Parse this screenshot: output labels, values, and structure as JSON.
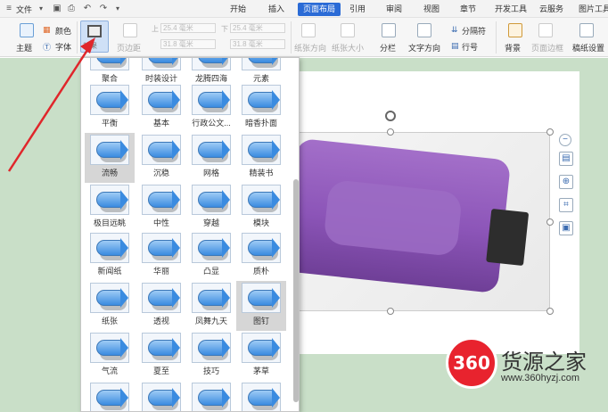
{
  "menubar": {
    "file_label": "文件",
    "tabs": [
      {
        "label": "开始",
        "active": false
      },
      {
        "label": "插入",
        "active": false
      },
      {
        "label": "页面布局",
        "active": true
      },
      {
        "label": "引用",
        "active": false
      },
      {
        "label": "审阅",
        "active": false
      },
      {
        "label": "视图",
        "active": false
      },
      {
        "label": "章节",
        "active": false
      },
      {
        "label": "开发工具",
        "active": false
      },
      {
        "label": "云服务",
        "active": false
      },
      {
        "label": "图片工具",
        "active": false
      }
    ]
  },
  "ribbon": {
    "theme_label": "主题",
    "color_label": "颜色",
    "font_label": "字体",
    "effect_label": "效果",
    "margin_label": "页边距",
    "top_label": "上",
    "bottom_label": "下",
    "top_value": "25.4 毫米",
    "bottom_value": "25.4 毫米",
    "left_value": "31.8 毫米",
    "right_value": "31.8 毫米",
    "orientation_label": "纸张方向",
    "size_label": "纸张大小",
    "columns_label": "分栏",
    "text_direction_label": "文字方向",
    "breaks_label": "分隔符",
    "line_number_label": "行号",
    "background_label": "背景",
    "page_border_label": "页面边框",
    "draft_label": "稿纸设置"
  },
  "gallery": {
    "rows": [
      [
        "聚合",
        "时装设计",
        "龙腾四海",
        "元素"
      ],
      [
        "平衡",
        "基本",
        "行政公文...",
        "暗香扑面"
      ],
      [
        "流畅",
        "沉稳",
        "网格",
        "精装书"
      ],
      [
        "极目远眺",
        "中性",
        "穿越",
        "模块"
      ],
      [
        "新闻纸",
        "华丽",
        "凸显",
        "质朴"
      ],
      [
        "纸张",
        "透视",
        "凤舞九天",
        "图钉"
      ],
      [
        "气流",
        "夏至",
        "技巧",
        "茅草"
      ],
      [
        "",
        "",
        "",
        ""
      ]
    ],
    "selected": [
      "流畅",
      "图钉"
    ]
  },
  "watermark": {
    "badge": "360",
    "title": "货源之家",
    "url": "www.360hyzj.com"
  },
  "colors": {
    "accent": "#2b6bd6",
    "annotation": "#e0262b",
    "workspace": "#c9dfc8"
  }
}
